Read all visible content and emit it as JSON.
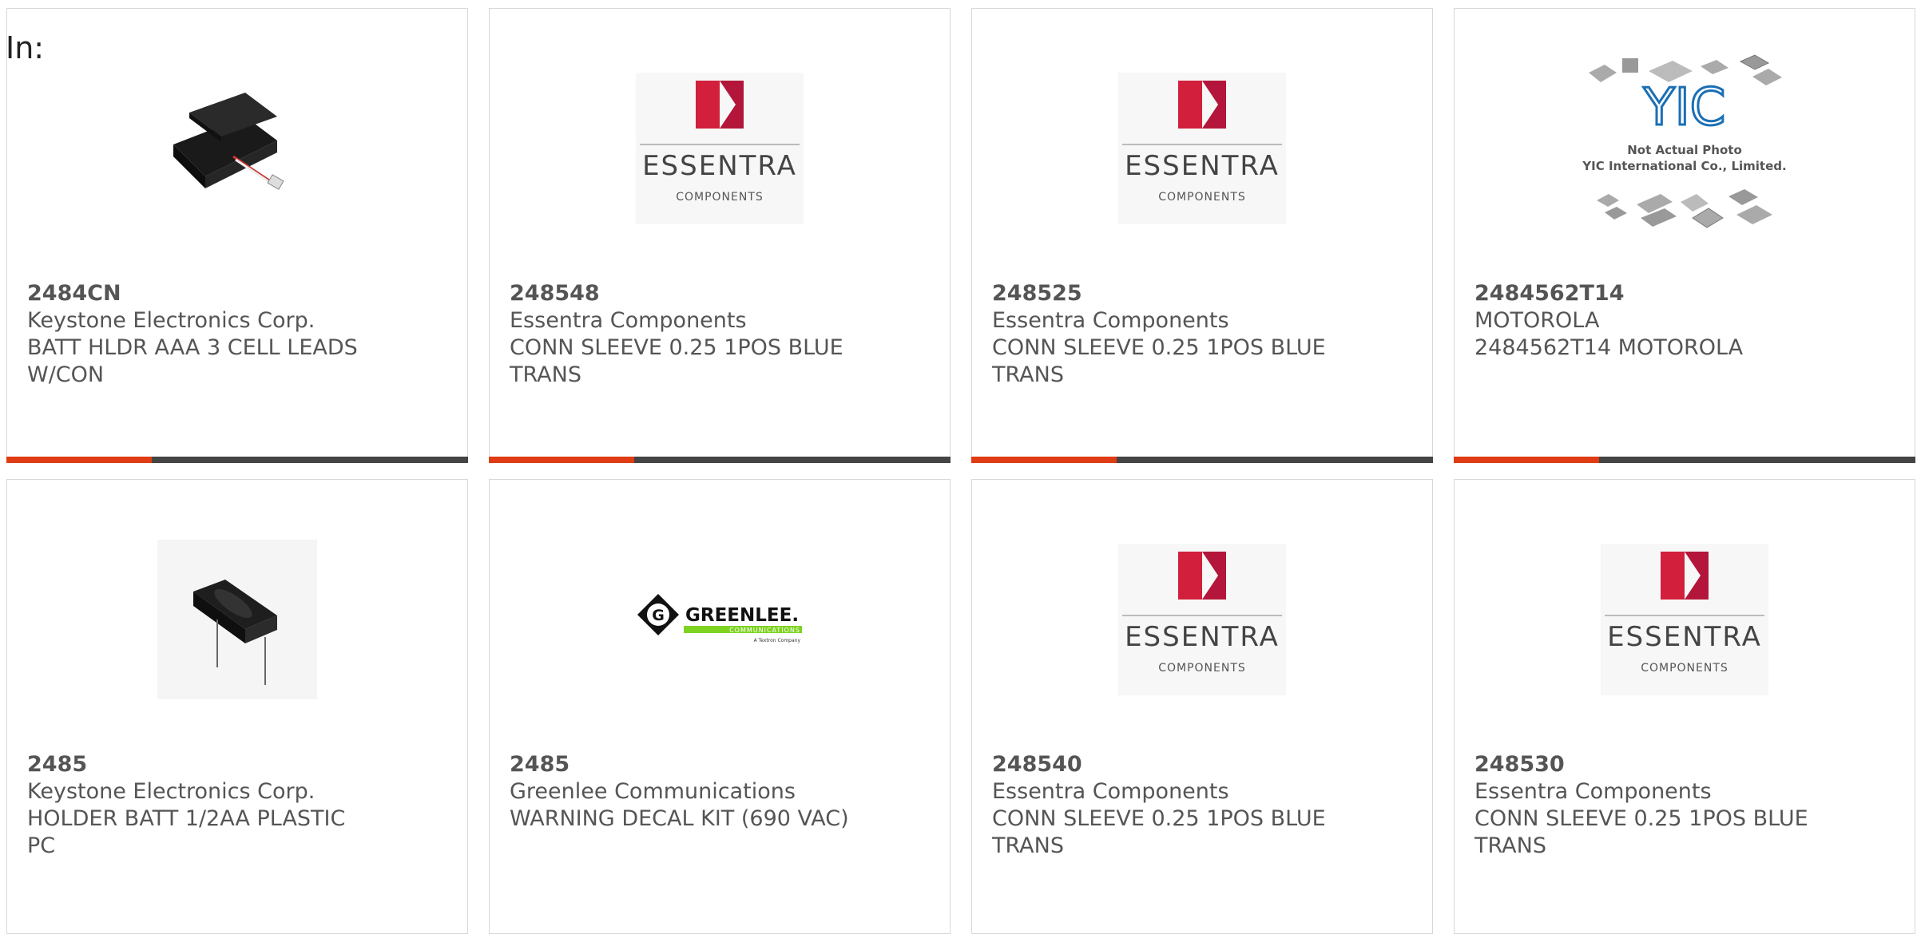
{
  "filter_label": "In:",
  "colors": {
    "accent": "#e03c14",
    "bar": "#444444",
    "text": "#555555"
  },
  "products": [
    {
      "part_number": "2484CN",
      "manufacturer": "Keystone Electronics Corp.",
      "description": "BATT HLDR AAA 3 CELL LEADS W/CON",
      "image": "battery-holder-aaa-image"
    },
    {
      "part_number": "248548",
      "manufacturer": "Essentra Components",
      "description": "CONN SLEEVE 0.25 1POS BLUE TRANS",
      "image": "essentra-logo",
      "logo": {
        "brand": "ESSENTRA",
        "sub": "COMPONENTS"
      }
    },
    {
      "part_number": "248525",
      "manufacturer": "Essentra Components",
      "description": "CONN SLEEVE 0.25 1POS BLUE TRANS",
      "image": "essentra-logo",
      "logo": {
        "brand": "ESSENTRA",
        "sub": "COMPONENTS"
      }
    },
    {
      "part_number": "2484562T14",
      "manufacturer": "MOTOROLA",
      "description": "2484562T14 MOTOROLA",
      "image": "yic-not-actual-photo",
      "logo": {
        "brand": "YIC",
        "line1": "Not Actual Photo",
        "line2": "YIC International Co., Limited."
      }
    },
    {
      "part_number": "2485",
      "manufacturer": "Keystone Electronics Corp.",
      "description": "HOLDER BATT 1/2AA PLASTIC PC",
      "image": "battery-holder-half-aa-image"
    },
    {
      "part_number": "2485",
      "manufacturer": "Greenlee Communications",
      "description": "WARNING DECAL KIT (690 VAC)",
      "image": "greenlee-logo",
      "logo": {
        "brand": "GREENLEE.",
        "sub": "COMMUNICATIONS",
        "tag": "A Textron Company"
      }
    },
    {
      "part_number": "248540",
      "manufacturer": "Essentra Components",
      "description": "CONN SLEEVE 0.25 1POS BLUE TRANS",
      "image": "essentra-logo",
      "logo": {
        "brand": "ESSENTRA",
        "sub": "COMPONENTS"
      }
    },
    {
      "part_number": "248530",
      "manufacturer": "Essentra Components",
      "description": "CONN SLEEVE 0.25 1POS BLUE TRANS",
      "image": "essentra-logo",
      "logo": {
        "brand": "ESSENTRA",
        "sub": "COMPONENTS"
      }
    }
  ]
}
